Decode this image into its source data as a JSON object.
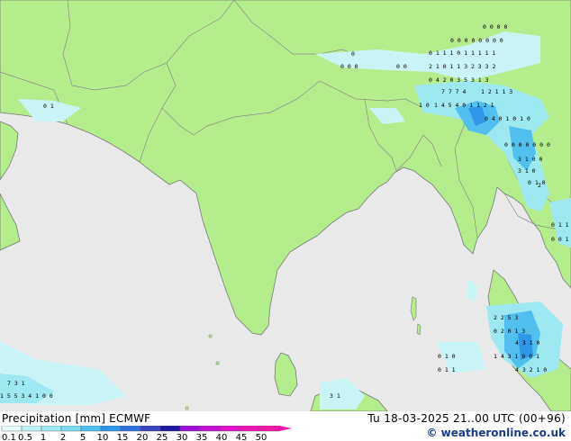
{
  "map": {
    "colors": {
      "sea": "#e9e9e9",
      "land": "#b4ee8c",
      "border": "#8a8a8a",
      "coast": "#7a7a7a"
    },
    "precip_numbers": [
      "0 0 0 0",
      "0 0 0 0 0 0 0 0",
      "0 0 0",
      "0 0",
      "2 1 0 1 1 3 2 3 3 2",
      "0 1 1 1 0 1 1 1 1 1",
      "0 4 2 0 3 5 3 1 3",
      "7 7 7 4",
      "1 2 1 1 3",
      "1 0",
      "1 4 5 4 0 1 1 2 1",
      "0 4 0 1 0 1 0",
      "0 0 0 0 0 0 0",
      "3 1 0 0",
      "3 1 0",
      "0 1 0",
      "2",
      "0 1 1",
      "0 0 1",
      "2 2 5 3",
      "0 2 0 1 3",
      "4 3 1 0",
      "1 4 3 1 9 0 1",
      "4 3 2 1 0",
      "0 1 0",
      "0 1 1",
      "7 3 1",
      "1 5 5 3 4 1 0 0",
      "3 1",
      "0",
      "0 1"
    ]
  },
  "footer": {
    "title": "Precipitation [mm]  ECMWF",
    "datetime": "Tu 18-03-2025 21..00 UTC (00+96)",
    "credit": "© weatheronline.co.uk",
    "scale_labels": [
      "0.1",
      "0.5",
      "1",
      "2",
      "5",
      "10",
      "15",
      "20",
      "25",
      "30",
      "35",
      "40",
      "45",
      "50"
    ],
    "scale_colors": [
      "#e6fbfb",
      "#bdf2f5",
      "#9ee8f2",
      "#7cd8f0",
      "#52c0ee",
      "#2f97e8",
      "#2f6fd8",
      "#3b44c0",
      "#1d1aa0",
      "#9a10d8",
      "#c60fd4",
      "#de12c6",
      "#ea14b4",
      "#f018a8"
    ]
  }
}
